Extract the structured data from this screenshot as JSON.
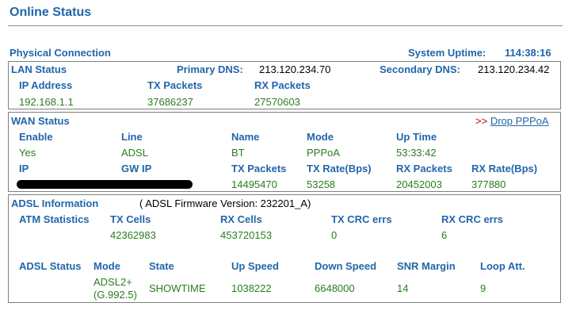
{
  "title": "Online Status",
  "physical": {
    "label": "Physical Connection",
    "uptime_label": "System Uptime:",
    "uptime_value": "114:38:16"
  },
  "lan": {
    "label": "LAN Status",
    "primary_dns_label": "Primary DNS:",
    "primary_dns_value": "213.120.234.70",
    "secondary_dns_label": "Secondary DNS:",
    "secondary_dns_value": "213.120.234.42",
    "headers": {
      "ip": "IP Address",
      "tx": "TX Packets",
      "rx": "RX Packets"
    },
    "values": {
      "ip": "192.168.1.1",
      "tx": "37686237",
      "rx": "27570603"
    }
  },
  "wan": {
    "label": "WAN Status",
    "drop_prefix": ">>",
    "drop_link": "Drop PPPoA",
    "row1_headers": {
      "enable": "Enable",
      "line": "Line",
      "name": "Name",
      "mode": "Mode",
      "uptime": "Up Time"
    },
    "row1_values": {
      "enable": "Yes",
      "line": "ADSL",
      "name": "BT",
      "mode": "PPPoA",
      "uptime": "53:33:42"
    },
    "row2_headers": {
      "ip": "IP",
      "gwip": "GW IP",
      "tx": "TX Packets",
      "txrate": "TX Rate(Bps)",
      "rx": "RX Packets",
      "rxrate": "RX Rate(Bps)"
    },
    "row2_values": {
      "tx": "14495470",
      "txrate": "53258",
      "rx": "20452003",
      "rxrate": "377880"
    }
  },
  "adsl": {
    "label": "ADSL Information",
    "firmware": "( ADSL Firmware Version:  232201_A)",
    "atm": {
      "label": "ATM Statistics",
      "headers": {
        "tx_cells": "TX Cells",
        "rx_cells": "RX Cells",
        "tx_crc": "TX CRC errs",
        "rx_crc": "RX CRC errs"
      },
      "values": {
        "tx_cells": "42362983",
        "rx_cells": "453720153",
        "tx_crc": "0",
        "rx_crc": "6"
      }
    },
    "status": {
      "label": "ADSL Status",
      "headers": {
        "mode": "Mode",
        "state": "State",
        "up": "Up Speed",
        "down": "Down Speed",
        "snr": "SNR Margin",
        "loop": "Loop Att."
      },
      "values": {
        "mode_line1": "ADSL2+",
        "mode_line2": "(G.992.5)",
        "state": "SHOWTIME",
        "up": "1038222",
        "down": "6648000",
        "snr": "14",
        "loop": "9"
      }
    }
  },
  "colors": {
    "header_blue": "#2266aa",
    "value_green": "#2a7d1f",
    "link_red": "#cc0000"
  }
}
